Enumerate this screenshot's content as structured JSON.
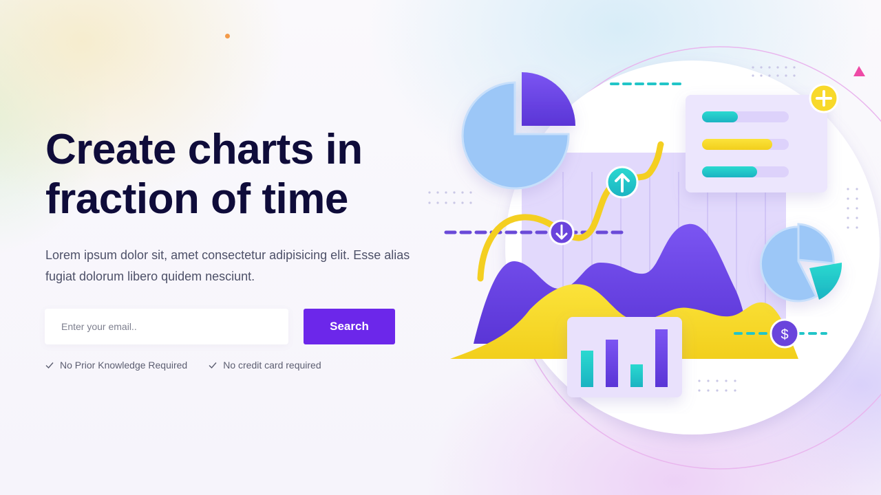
{
  "hero": {
    "title_line1": "Create charts in",
    "title_line2": "fraction of time",
    "description": "Lorem ipsum dolor sit, amet consectetur adipisicing elit. Esse alias fugiat dolorum libero quidem nesciunt."
  },
  "form": {
    "email_placeholder": "Enter your email..",
    "email_value": "",
    "search_label": "Search"
  },
  "features": [
    {
      "label": "No Prior Knowledge Required",
      "icon": "check-icon"
    },
    {
      "label": "No credit card required",
      "icon": "check-icon"
    }
  ],
  "illustration": {
    "badges": {
      "dollar": "$"
    },
    "colors": {
      "purple": "#6c27ea",
      "violet": "#7a5bf0",
      "yellow": "#f7dc2c",
      "teal": "#22c5c8",
      "light_blue": "#9cc7f7",
      "lavender": "#ddd2fb",
      "title": "#0f0c3a"
    }
  }
}
